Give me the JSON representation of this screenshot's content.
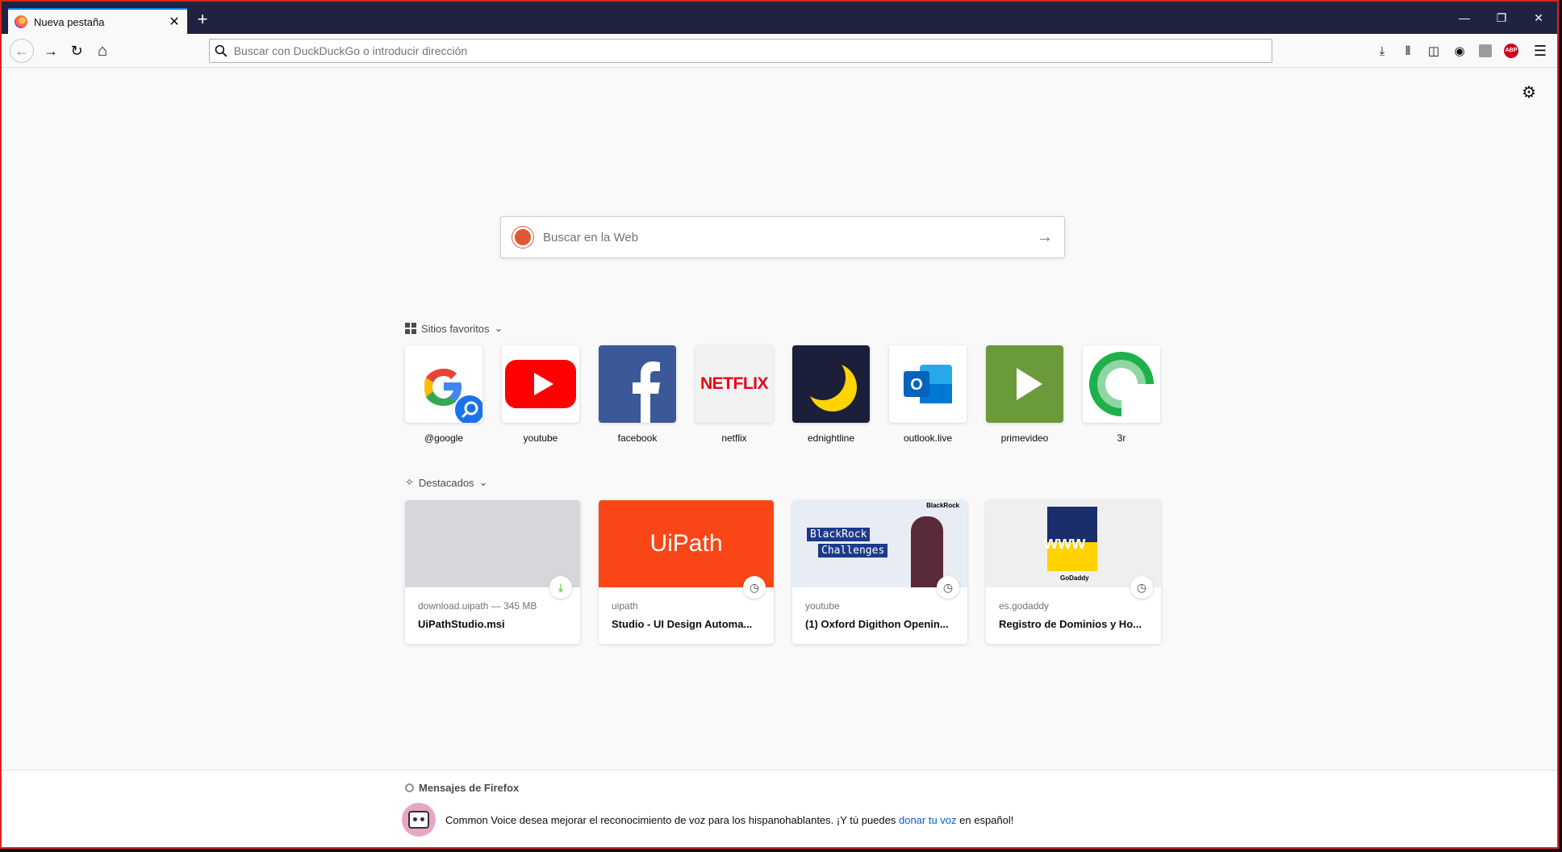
{
  "tab": {
    "title": "Nueva pestaña",
    "close": "✕",
    "new_tab": "+"
  },
  "window_controls": {
    "minimize": "—",
    "restore": "❐",
    "close": "✕"
  },
  "navbar": {
    "back": "←",
    "forward": "→",
    "reload": "↻",
    "home": "⌂",
    "url_placeholder": "Buscar con DuckDuckGo o introducir dirección"
  },
  "toolbar_icons": [
    "download-icon",
    "library-icon",
    "sidebar-icon",
    "account-icon",
    "extension-icon",
    "adblock-icon",
    "menu-icon"
  ],
  "adblock_label": "ABP",
  "search": {
    "placeholder": "Buscar en la Web",
    "arrow": "→"
  },
  "top_sites": {
    "title": "Sitios favoritos",
    "items": [
      {
        "label": "@google",
        "color": "#ffffff"
      },
      {
        "label": "youtube",
        "color": "#ffffff"
      },
      {
        "label": "facebook",
        "color": "#3b5998"
      },
      {
        "label": "netflix",
        "color": "#f2f2f2"
      },
      {
        "label": "ednightline",
        "color": "#1c1f3a"
      },
      {
        "label": "outlook.live",
        "color": "#ffffff"
      },
      {
        "label": "primevideo",
        "color": "#6b9a3a"
      },
      {
        "label": "3r",
        "color": "#ffffff"
      }
    ]
  },
  "highlights": {
    "title": "Destacados",
    "items": [
      {
        "host": "download.uipath — 345 MB",
        "title": "UiPathStudio.msi",
        "badge": "⤓"
      },
      {
        "host": "uipath",
        "title": "Studio - UI Design Automa...",
        "badge": "◷",
        "thumb_text": "UiPath"
      },
      {
        "host": "youtube",
        "title": "(1) Oxford Digithon Openin...",
        "badge": "◷",
        "thumb_lines": [
          "BlackRock",
          "Challenges"
        ],
        "thumb_brand": "BlackRock"
      },
      {
        "host": "es.godaddy",
        "title": "Registro de Dominios y Ho...",
        "badge": "◷",
        "thumb_text": "www",
        "thumb_brand": "GoDaddy"
      }
    ]
  },
  "netflix_label": "NETFLIX",
  "messages": {
    "title": "Mensajes de Firefox",
    "text_before": "Common Voice desea mejorar el reconocimiento de voz para los hispanohablantes. ¡Y tú puedes ",
    "link": "donar tu voz",
    "text_after": " en español!"
  }
}
